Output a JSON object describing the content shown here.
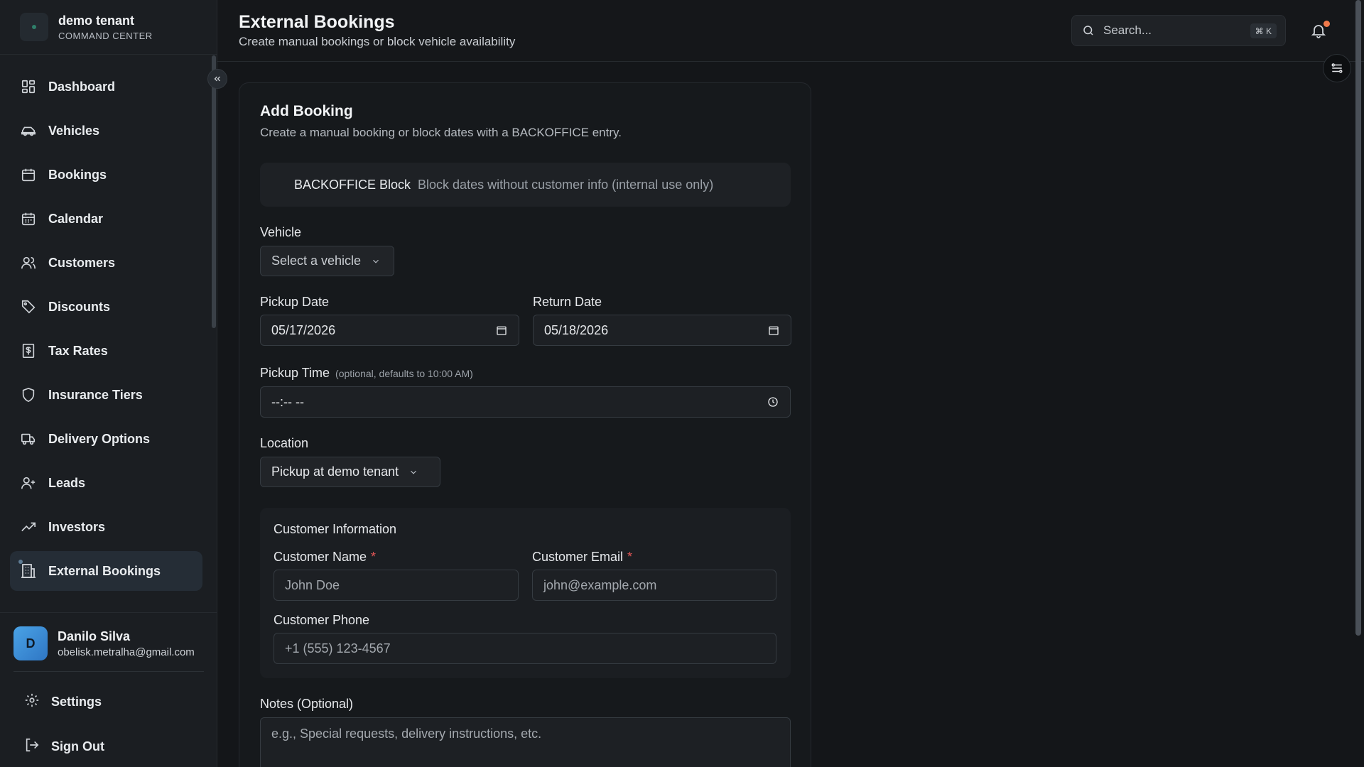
{
  "brand": {
    "name": "demo tenant",
    "subtitle": "COMMAND CENTER"
  },
  "sidebar": {
    "items": [
      {
        "label": "Dashboard",
        "icon": "dashboard-icon"
      },
      {
        "label": "Vehicles",
        "icon": "car-icon"
      },
      {
        "label": "Bookings",
        "icon": "calendar-icon"
      },
      {
        "label": "Calendar",
        "icon": "calendar-grid-icon"
      },
      {
        "label": "Customers",
        "icon": "users-icon"
      },
      {
        "label": "Discounts",
        "icon": "tag-icon"
      },
      {
        "label": "Tax Rates",
        "icon": "receipt-icon"
      },
      {
        "label": "Insurance Tiers",
        "icon": "shield-icon"
      },
      {
        "label": "Delivery Options",
        "icon": "truck-icon"
      },
      {
        "label": "Leads",
        "icon": "user-plus-icon"
      },
      {
        "label": "Investors",
        "icon": "trending-up-icon"
      },
      {
        "label": "External Bookings",
        "icon": "building-icon",
        "active": true
      }
    ]
  },
  "user": {
    "initial": "D",
    "name": "Danilo Silva",
    "email": "obelisk.metralha@gmail.com"
  },
  "bottom": {
    "settings": "Settings",
    "signout": "Sign Out"
  },
  "header": {
    "title": "External Bookings",
    "subtitle": "Create manual bookings or block vehicle availability",
    "search_placeholder": "Search...",
    "shortcut": "⌘ K"
  },
  "form": {
    "title": "Add Booking",
    "subtitle": "Create a manual booking or block dates with a BACKOFFICE entry.",
    "backoffice": {
      "title": "BACKOFFICE Block",
      "desc": "Block dates without customer info (internal use only)"
    },
    "vehicle": {
      "label": "Vehicle",
      "value": "Select a vehicle"
    },
    "pickup_date": {
      "label": "Pickup Date",
      "value": "05/17/2026"
    },
    "return_date": {
      "label": "Return Date",
      "value": "05/18/2026"
    },
    "pickup_time": {
      "label": "Pickup Time",
      "hint": "(optional, defaults to 10:00 AM)",
      "value": "--:-- --"
    },
    "location": {
      "label": "Location",
      "value": "Pickup at demo tenant"
    },
    "customer": {
      "section_title": "Customer Information",
      "name": {
        "label": "Customer Name",
        "placeholder": "John Doe",
        "required_mark": "*"
      },
      "email": {
        "label": "Customer Email",
        "placeholder": "john@example.com",
        "required_mark": "*"
      },
      "phone": {
        "label": "Customer Phone",
        "placeholder": "+1 (555) 123-4567"
      }
    },
    "notes": {
      "label": "Notes (Optional)",
      "placeholder": "e.g., Special requests, delivery instructions, etc."
    }
  },
  "colors": {
    "accent": "#f07a4b",
    "active_bg": "#252d36",
    "required": "#e05555"
  }
}
